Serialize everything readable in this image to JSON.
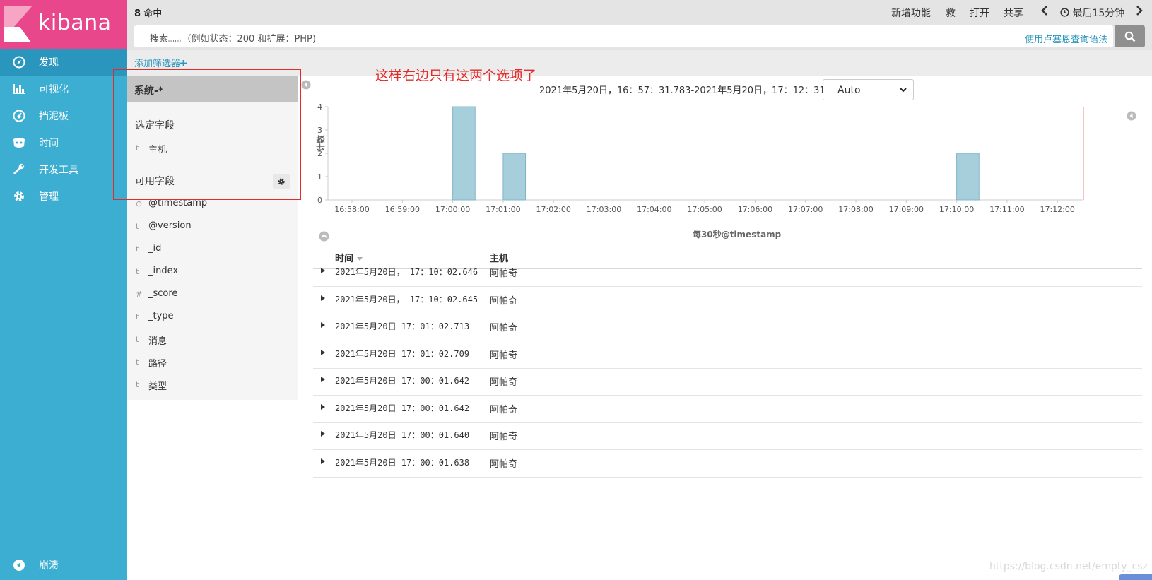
{
  "app": {
    "name": "kibana"
  },
  "sidebar": {
    "items": [
      {
        "label": "发现",
        "icon": "compass-icon"
      },
      {
        "label": "可视化",
        "icon": "bar-chart-icon"
      },
      {
        "label": "挡泥板",
        "icon": "dashboard-icon"
      },
      {
        "label": "时间",
        "icon": "timelion-icon"
      },
      {
        "label": "开发工具",
        "icon": "wrench-icon"
      },
      {
        "label": "管理",
        "icon": "gear-icon"
      }
    ],
    "collapse_label": "崩溃"
  },
  "topbar": {
    "hits_count": "8",
    "hits_label": "命中",
    "new_label": "新增功能",
    "save_label": "救",
    "open_label": "打开",
    "share_label": "共享",
    "time_label": "最后15分钟"
  },
  "search": {
    "placeholder": "搜索。。。（例如状态：200 和扩展：PHP)",
    "lucene_link": "使用卢塞恩查询语法"
  },
  "filter": {
    "add_label": "添加筛选器"
  },
  "fields": {
    "index_pattern": "系统-*",
    "selected_title": "选定字段",
    "selected": [
      {
        "type": "t",
        "name": "主机"
      }
    ],
    "available_title": "可用字段",
    "available": [
      {
        "type": "⊙",
        "name": "@timestamp"
      },
      {
        "type": "t",
        "name": "@version"
      },
      {
        "type": "t",
        "name": "_id"
      },
      {
        "type": "t",
        "name": "_index"
      },
      {
        "type": "#",
        "name": "_score"
      },
      {
        "type": "t",
        "name": "_type"
      },
      {
        "type": "t",
        "name": "消息"
      },
      {
        "type": "t",
        "name": "路径"
      },
      {
        "type": "t",
        "name": "类型"
      }
    ]
  },
  "annotation": {
    "text": "这样右边只有这两个选项了",
    "color": "#e42b2b"
  },
  "chart": {
    "time_range": "2021年5月20日，16：57：31.783-2021年5月20日，17：12：31.783-",
    "interval": "Auto",
    "ylabel": "计数",
    "xlabel": "每30秒@timestamp"
  },
  "chart_data": {
    "type": "bar",
    "x_ticks": [
      "16:58:00",
      "16:59:00",
      "17:00:00",
      "17:01:00",
      "17:02:00",
      "17:03:00",
      "17:04:00",
      "17:05:00",
      "17:06:00",
      "17:07:00",
      "17:08:00",
      "17:09:00",
      "17:10:00",
      "17:11:00",
      "17:12:00"
    ],
    "bars": [
      {
        "x": "17:00:00",
        "value": 4
      },
      {
        "x": "17:01:00",
        "value": 2
      },
      {
        "x": "17:10:00",
        "value": 2
      }
    ],
    "ylim": [
      0,
      4
    ],
    "y_ticks": [
      0,
      1,
      2,
      3,
      4
    ],
    "bar_color": "#a7cfdb",
    "ylabel": "计数",
    "xlabel": "每30秒@timestamp"
  },
  "table": {
    "headers": {
      "time": "时间",
      "host": "主机"
    },
    "rows": [
      {
        "time": "2021年5月20日，  17：10：02.646",
        "host": "阿帕奇"
      },
      {
        "time": "2021年5月20日，  17：10：02.645",
        "host": "阿帕奇"
      },
      {
        "time": "2021年5月20日 17：01：02.713",
        "host": "阿帕奇"
      },
      {
        "time": "2021年5月20日 17：01：02.709",
        "host": "阿帕奇"
      },
      {
        "time": "2021年5月20日 17：00：01.642",
        "host": "阿帕奇"
      },
      {
        "time": "2021年5月20日 17：00：01.642",
        "host": "阿帕奇"
      },
      {
        "time": "2021年5月20日 17：00：01.640",
        "host": "阿帕奇"
      },
      {
        "time": "2021年5月20日 17：00：01.638",
        "host": "阿帕奇"
      }
    ]
  },
  "watermark": "https://blog.csdn.net/empty_csz"
}
